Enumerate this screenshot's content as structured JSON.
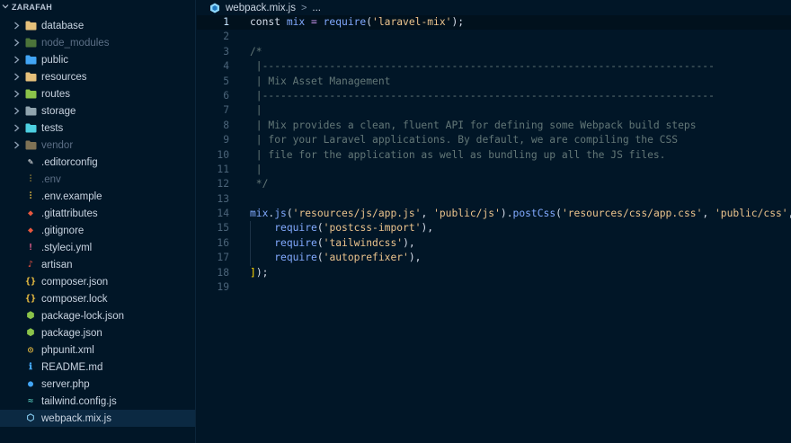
{
  "explorer": {
    "title": "ZARAFAH",
    "items": [
      {
        "label": "database",
        "type": "folder",
        "color": "#e5c07b",
        "dim": false,
        "icon": "database-folder-icon"
      },
      {
        "label": "node_modules",
        "type": "folder",
        "color": "#8bc34a",
        "dim": true,
        "icon": "node-modules-folder-icon"
      },
      {
        "label": "public",
        "type": "folder",
        "color": "#42a5f5",
        "dim": false,
        "icon": "public-folder-icon"
      },
      {
        "label": "resources",
        "type": "folder",
        "color": "#e5c07b",
        "dim": false,
        "icon": "resources-folder-icon"
      },
      {
        "label": "routes",
        "type": "folder",
        "color": "#8bc34a",
        "dim": false,
        "icon": "routes-folder-icon"
      },
      {
        "label": "storage",
        "type": "folder",
        "color": "#90a4ae",
        "dim": false,
        "icon": "storage-folder-icon"
      },
      {
        "label": "tests",
        "type": "folder",
        "color": "#4dd0e1",
        "dim": false,
        "icon": "tests-folder-icon"
      },
      {
        "label": "vendor",
        "type": "folder",
        "color": "#e5c07b",
        "dim": true,
        "icon": "vendor-folder-icon"
      },
      {
        "label": ".editorconfig",
        "type": "file",
        "glyph": "✎",
        "color": "#ffffff",
        "dim": false,
        "icon": "editorconfig-icon"
      },
      {
        "label": ".env",
        "type": "file",
        "glyph": "⫶",
        "color": "#f4c542",
        "dim": true,
        "icon": "env-icon"
      },
      {
        "label": ".env.example",
        "type": "file",
        "glyph": "⫶",
        "color": "#f4c542",
        "dim": false,
        "icon": "env-example-icon"
      },
      {
        "label": ".gitattributes",
        "type": "file",
        "glyph": "◆",
        "color": "#e8583f",
        "dim": false,
        "icon": "git-icon"
      },
      {
        "label": ".gitignore",
        "type": "file",
        "glyph": "◆",
        "color": "#e8583f",
        "dim": false,
        "icon": "gitignore-icon"
      },
      {
        "label": ".styleci.yml",
        "type": "file",
        "glyph": "!",
        "color": "#f06292",
        "dim": false,
        "icon": "yaml-icon"
      },
      {
        "label": "artisan",
        "type": "file",
        "glyph": "♪",
        "color": "#f05340",
        "dim": false,
        "icon": "laravel-icon"
      },
      {
        "label": "composer.json",
        "type": "file",
        "glyph": "{}",
        "color": "#f4c542",
        "dim": false,
        "icon": "json-icon"
      },
      {
        "label": "composer.lock",
        "type": "file",
        "glyph": "{}",
        "color": "#f4c542",
        "dim": false,
        "icon": "lock-json-icon"
      },
      {
        "label": "package-lock.json",
        "type": "file",
        "glyph": "⬢",
        "color": "#8bc34a",
        "dim": false,
        "icon": "nodejs-icon"
      },
      {
        "label": "package.json",
        "type": "file",
        "glyph": "⬢",
        "color": "#8bc34a",
        "dim": false,
        "icon": "nodejs-icon"
      },
      {
        "label": "phpunit.xml",
        "type": "file",
        "glyph": "◎",
        "color": "#f4c542",
        "dim": false,
        "icon": "phpunit-icon"
      },
      {
        "label": "README.md",
        "type": "file",
        "glyph": "ℹ",
        "color": "#42a5f5",
        "dim": false,
        "icon": "info-icon"
      },
      {
        "label": "server.php",
        "type": "file",
        "glyph": "●",
        "color": "#42a5f5",
        "dim": false,
        "icon": "php-icon"
      },
      {
        "label": "tailwind.config.js",
        "type": "file",
        "glyph": "≈",
        "color": "#4db6ac",
        "dim": false,
        "icon": "tailwind-icon"
      },
      {
        "label": "webpack.mix.js",
        "type": "file",
        "glyph": "⬡",
        "color": "#8ed6fb",
        "dim": false,
        "selected": true,
        "icon": "webpack-icon"
      }
    ]
  },
  "breadcrumb": {
    "file": "webpack.mix.js",
    "separator": ">",
    "rest": "..."
  },
  "editor": {
    "current_line": 1,
    "lines": [
      {
        "n": "1",
        "tokens": [
          [
            "const ",
            "kw-plain"
          ],
          [
            "mix",
            "var"
          ],
          [
            " = ",
            "op"
          ],
          [
            "require",
            "fn"
          ],
          [
            "(",
            "pun"
          ],
          [
            "'laravel-mix'",
            "str"
          ],
          [
            ");",
            "pun"
          ]
        ]
      },
      {
        "n": "2",
        "tokens": []
      },
      {
        "n": "3",
        "tokens": [
          [
            "/*",
            "cmt"
          ]
        ]
      },
      {
        "n": "4",
        "tokens": [
          [
            " |--------------------------------------------------------------------------",
            "cmt"
          ]
        ]
      },
      {
        "n": "5",
        "tokens": [
          [
            " | Mix Asset Management",
            "cmt"
          ]
        ]
      },
      {
        "n": "6",
        "tokens": [
          [
            " |--------------------------------------------------------------------------",
            "cmt"
          ]
        ]
      },
      {
        "n": "7",
        "tokens": [
          [
            " |",
            "cmt"
          ]
        ]
      },
      {
        "n": "8",
        "tokens": [
          [
            " | Mix provides a clean, fluent API for defining some Webpack build steps",
            "cmt"
          ]
        ]
      },
      {
        "n": "9",
        "tokens": [
          [
            " | for your Laravel applications. By default, we are compiling the CSS",
            "cmt"
          ]
        ]
      },
      {
        "n": "10",
        "tokens": [
          [
            " | file for the application as well as bundling up all the JS files.",
            "cmt"
          ]
        ]
      },
      {
        "n": "11",
        "tokens": [
          [
            " |",
            "cmt"
          ]
        ]
      },
      {
        "n": "12",
        "tokens": [
          [
            " */",
            "cmt"
          ]
        ]
      },
      {
        "n": "13",
        "tokens": []
      },
      {
        "n": "14",
        "tokens": [
          [
            "mix",
            "var"
          ],
          [
            ".",
            "pun"
          ],
          [
            "js",
            "fn"
          ],
          [
            "(",
            "pun"
          ],
          [
            "'resources/js/app.js'",
            "str"
          ],
          [
            ", ",
            "pun"
          ],
          [
            "'public/js'",
            "str"
          ],
          [
            ").",
            "pun"
          ],
          [
            "postCss",
            "fn"
          ],
          [
            "(",
            "pun"
          ],
          [
            "'resources/css/app.css'",
            "str"
          ],
          [
            ", ",
            "pun"
          ],
          [
            "'public/css'",
            "str"
          ],
          [
            ", ",
            "pun"
          ],
          [
            "[",
            "yel"
          ]
        ]
      },
      {
        "n": "15",
        "tokens": [
          [
            "    ",
            "pun"
          ],
          [
            "require",
            "fn"
          ],
          [
            "(",
            "pun"
          ],
          [
            "'postcss-import'",
            "str"
          ],
          [
            "),",
            "pun"
          ]
        ]
      },
      {
        "n": "16",
        "tokens": [
          [
            "    ",
            "pun"
          ],
          [
            "require",
            "fn"
          ],
          [
            "(",
            "pun"
          ],
          [
            "'tailwindcss'",
            "str"
          ],
          [
            "),",
            "pun"
          ]
        ]
      },
      {
        "n": "17",
        "tokens": [
          [
            "    ",
            "pun"
          ],
          [
            "require",
            "fn"
          ],
          [
            "(",
            "pun"
          ],
          [
            "'autoprefixer'",
            "str"
          ],
          [
            "),",
            "pun"
          ]
        ]
      },
      {
        "n": "18",
        "tokens": [
          [
            "]",
            "yel"
          ],
          [
            ");",
            "pun"
          ]
        ]
      },
      {
        "n": "19",
        "tokens": []
      }
    ]
  }
}
